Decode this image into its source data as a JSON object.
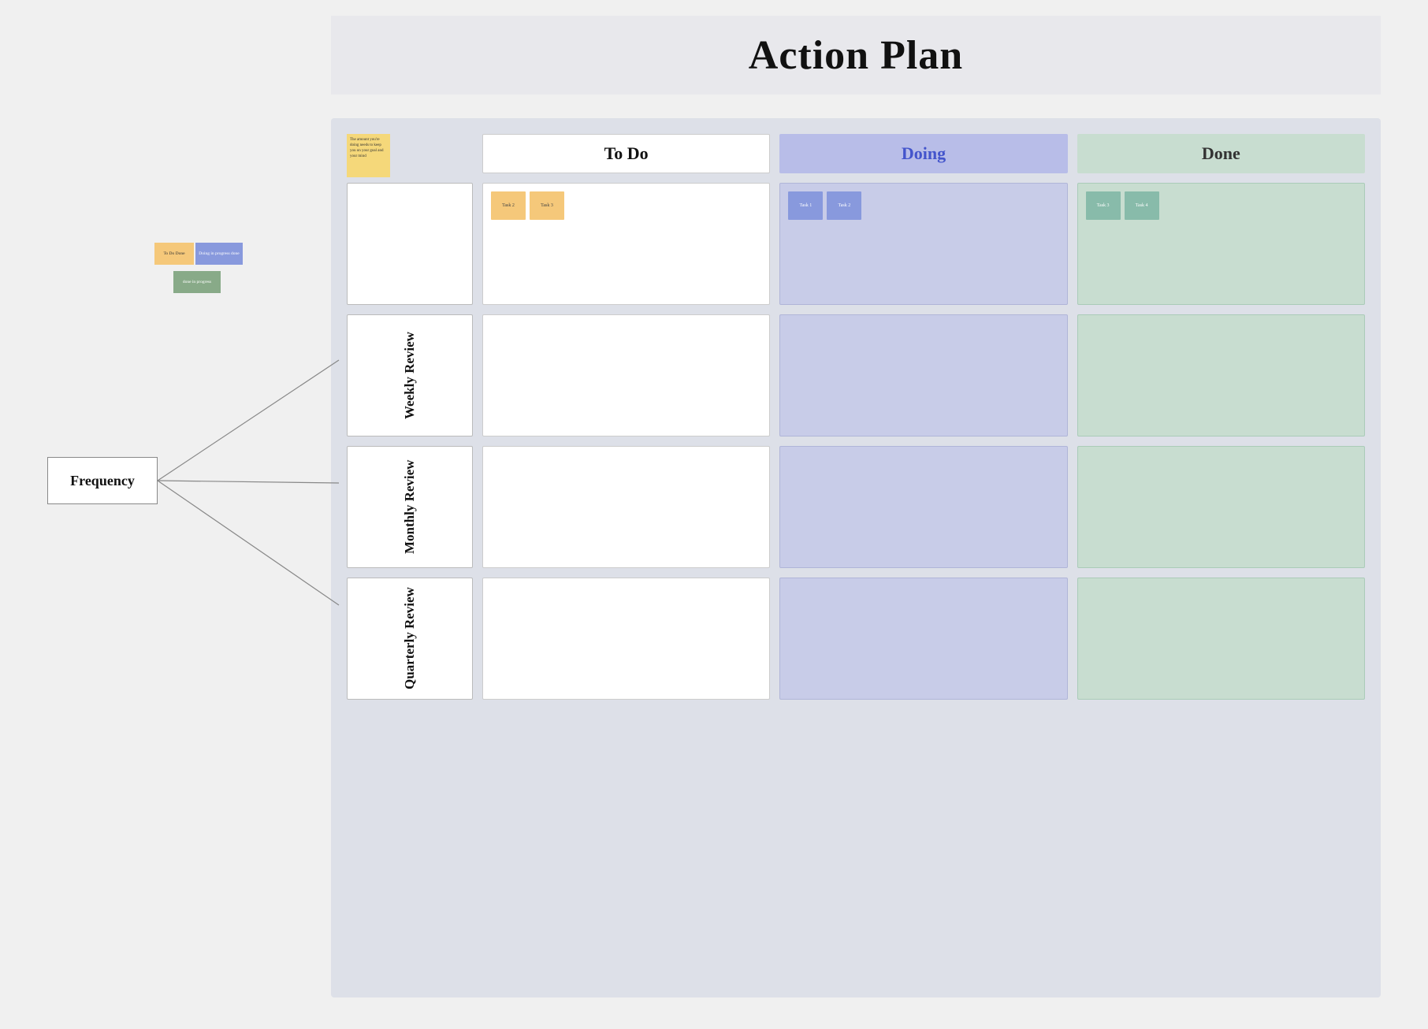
{
  "page": {
    "title": "Action Plan",
    "background": "#f0f0f0"
  },
  "header": {
    "col_empty": "",
    "col_todo": "To Do",
    "col_doing": "Doing",
    "col_done": "Done"
  },
  "corner_sticky": {
    "text": "The amount you're doing needs to keep you on your goal and your mind"
  },
  "rows": [
    {
      "label": "",
      "label_empty": true,
      "todo_tasks": [
        {
          "id": "Task 2",
          "color": "orange"
        },
        {
          "id": "Task 3",
          "color": "orange"
        }
      ],
      "doing_tasks": [
        {
          "id": "Task 1",
          "color": "blue"
        },
        {
          "id": "Task 2",
          "color": "blue"
        }
      ],
      "done_tasks": [
        {
          "id": "Task 3",
          "color": "green"
        },
        {
          "id": "Task 4",
          "color": "green"
        }
      ]
    },
    {
      "label": "Weekly Review",
      "label_empty": false,
      "todo_tasks": [],
      "doing_tasks": [],
      "done_tasks": []
    },
    {
      "label": "Monthly Review",
      "label_empty": false,
      "todo_tasks": [],
      "doing_tasks": [],
      "done_tasks": []
    },
    {
      "label": "Quarterly Review",
      "label_empty": false,
      "todo_tasks": [],
      "doing_tasks": [],
      "done_tasks": []
    }
  ],
  "frequency": {
    "label": "Frequency"
  },
  "float_stickies": {
    "todo": "To Do Done",
    "doing": "Doing in progress done",
    "inprogress": "done in progress"
  }
}
